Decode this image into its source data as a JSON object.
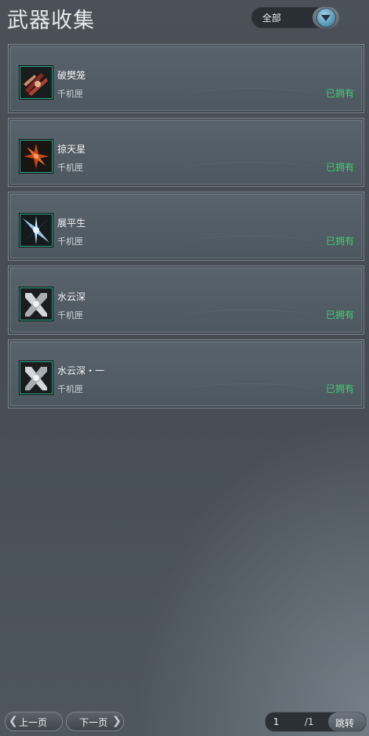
{
  "header": {
    "title": "武器收集"
  },
  "filter": {
    "selected": "全部"
  },
  "items": [
    {
      "name": "破樊笼",
      "type": "千机匣",
      "status": "已拥有",
      "icon": "weapon-icon-red-blades"
    },
    {
      "name": "掠天星",
      "type": "千机匣",
      "status": "已拥有",
      "icon": "weapon-icon-orange-star"
    },
    {
      "name": "展平生",
      "type": "千机匣",
      "status": "已拥有",
      "icon": "weapon-icon-blue-shuriken"
    },
    {
      "name": "水云深",
      "type": "千机匣",
      "status": "已拥有",
      "icon": "weapon-icon-silver-cross"
    },
    {
      "name": "水云深・一",
      "type": "千机匣",
      "status": "已拥有",
      "icon": "weapon-icon-silver-cross"
    }
  ],
  "pagination": {
    "prev_label": "上一页",
    "next_label": "下一页",
    "current_page": "1",
    "total": "/1",
    "jump_label": "跳转"
  },
  "colors": {
    "owned": "#3fd070",
    "thumb_border": "#2fa98a"
  }
}
